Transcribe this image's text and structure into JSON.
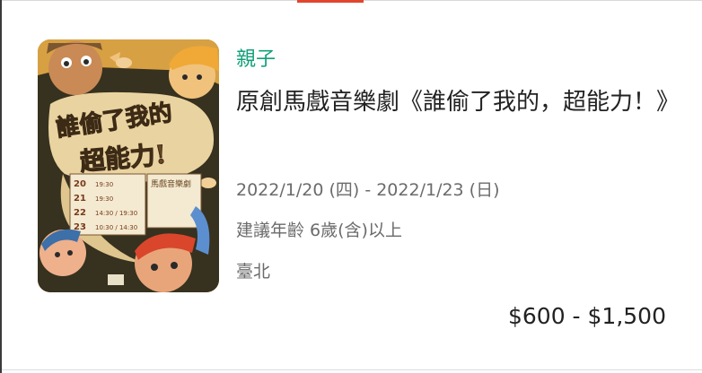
{
  "event": {
    "category": "親子",
    "title": "原創馬戲音樂劇《誰偷了我的，超能力！》",
    "date_range": "2022/1/20 (四) - 2022/1/23 (日)",
    "age": "建議年齡 6歲(含)以上",
    "venue": "臺北",
    "price": "$600 - $1,500"
  },
  "poster": {
    "title_line1": "誰偷了我的",
    "title_line2": "超能力!",
    "subtitle": "馬戲音樂劇",
    "schedule": [
      {
        "day": "20",
        "times": "19:30"
      },
      {
        "day": "21",
        "times": "19:30"
      },
      {
        "day": "22",
        "times": "14:30 / 19:30"
      },
      {
        "day": "23",
        "times": "10:30 / 14:30"
      }
    ]
  },
  "colors": {
    "accent": "#12a07a",
    "tab_indicator": "#e1452e",
    "text_primary": "#222222",
    "text_secondary": "#6b6b6b"
  }
}
